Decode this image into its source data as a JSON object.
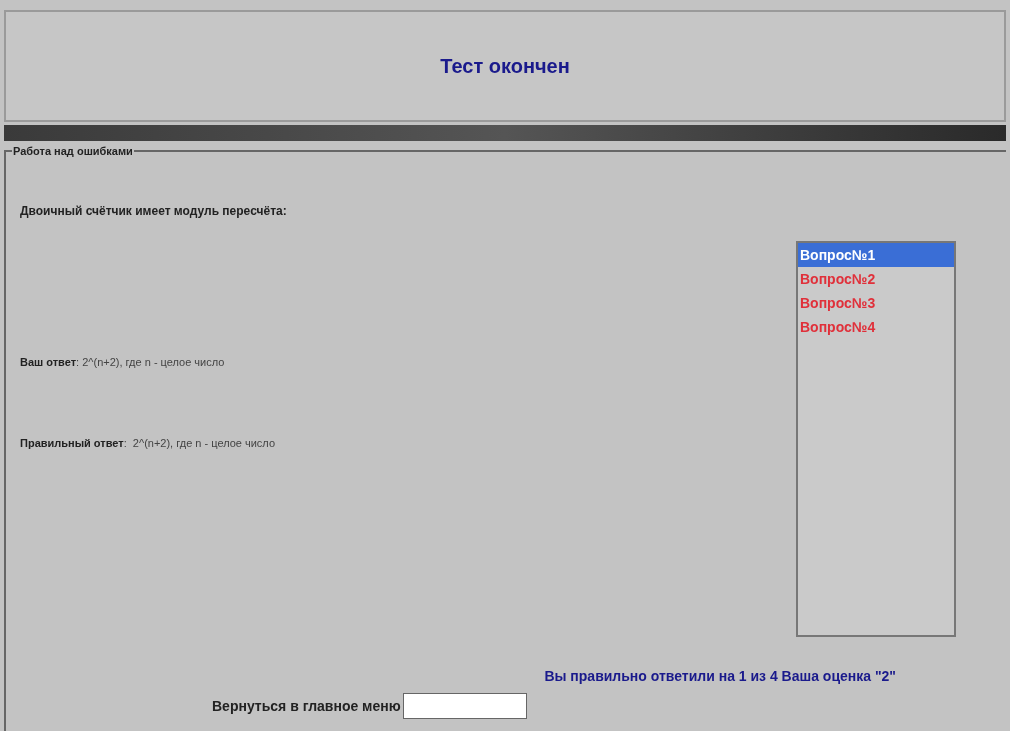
{
  "header": {
    "title": "Тест окончен"
  },
  "section": {
    "legend": "Работа над ошибками",
    "question": "Двоичный счётчик имеет модуль пересчёта:",
    "answers": [
      "**Ваш ответ**: 2^(n+2), где n - целое число",
      "**Правильный ответ**:  2^(n+2), где n - целое число"
    ],
    "questions_list": [
      {
        "label": "Вопрос№1",
        "selected": true
      },
      {
        "label": "Вопрос№2",
        "selected": false
      },
      {
        "label": "Вопрос№3",
        "selected": false
      },
      {
        "label": "Вопрос№4",
        "selected": false
      }
    ]
  },
  "result": "Вы правильно ответили на 1 из 4 Ваша оценка \"2\"",
  "back_menu": {
    "label": "Вернуться в главное меню"
  }
}
